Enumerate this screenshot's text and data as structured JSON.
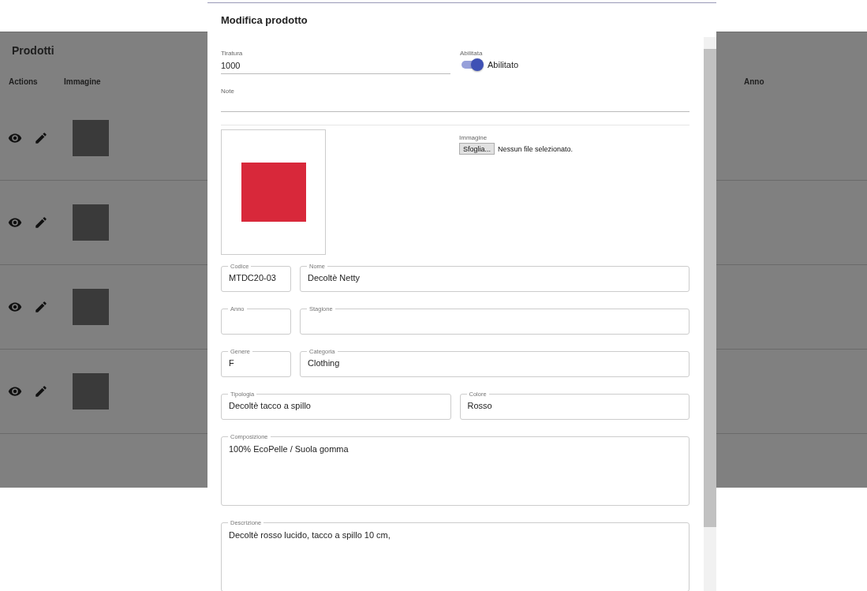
{
  "page": {
    "title": "Prodotti",
    "columns": [
      "Actions",
      "Immagine",
      "Anno"
    ],
    "rows": [
      {
        "actions": [
          {
            "kind": "view"
          },
          {
            "kind": "edit"
          }
        ]
      },
      {
        "actions": [
          {
            "kind": "view"
          },
          {
            "kind": "edit"
          }
        ]
      },
      {
        "actions": [
          {
            "kind": "view"
          },
          {
            "kind": "edit"
          }
        ]
      },
      {
        "actions": [
          {
            "kind": "view"
          },
          {
            "kind": "edit"
          }
        ]
      }
    ]
  },
  "dialog": {
    "title": "Modifica prodotto",
    "tiratura": {
      "label": "Tiratura",
      "value": "1000"
    },
    "enabled": {
      "label": "Abilitata",
      "on": true,
      "text": "Abilitato"
    },
    "note": {
      "label": "Note"
    },
    "upload": {
      "label": "Immagine",
      "button": "Sfoglia...",
      "status": "Nessun file selezionato."
    },
    "field_rows": [
      {
        "kind": "narrow_wide",
        "fields": [
          {
            "label": "Codice",
            "value": "MTDC20-03"
          },
          {
            "label": "Nome",
            "value": "Decoltè Netty"
          }
        ]
      },
      {
        "kind": "narrow_wide",
        "fields": [
          {
            "label": "Anno"
          },
          {
            "label": "Stagione"
          }
        ]
      },
      {
        "kind": "narrow_wide",
        "fields": [
          {
            "label": "Genere",
            "value": "F"
          },
          {
            "label": "Categoria",
            "value": "Clothing"
          }
        ]
      },
      {
        "kind": "halves",
        "fields": [
          {
            "label": "Tipologia",
            "value": "Decoltè tacco a spillo"
          },
          {
            "label": "Colore",
            "value": "Rosso"
          }
        ]
      },
      {
        "kind": "textarea",
        "fields": [
          {
            "label": "Composizione",
            "value": "100% EcoPelle / Suola gomma"
          }
        ]
      },
      {
        "kind": "textarea",
        "fields": [
          {
            "label": "Descrizione",
            "value": "Decoltè rosso lucido, tacco a spillo 10 cm,"
          }
        ]
      }
    ]
  }
}
